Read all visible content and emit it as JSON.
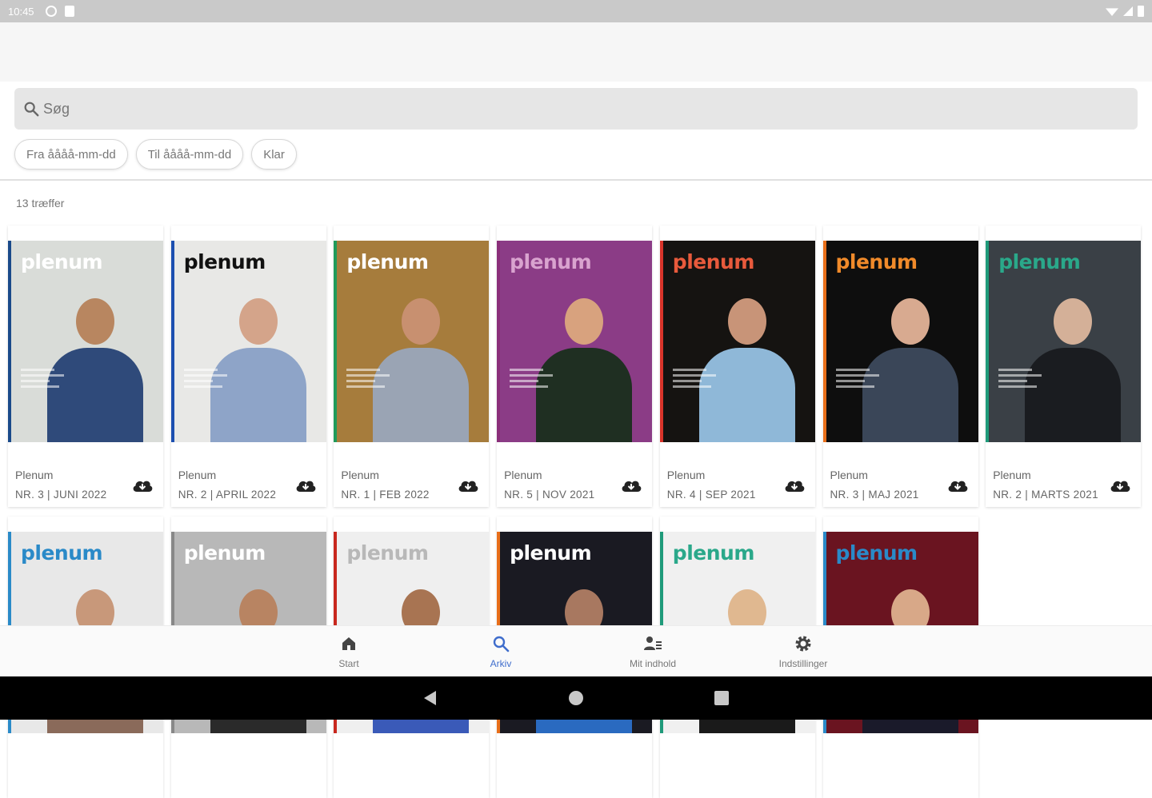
{
  "status_bar": {
    "time": "10:45"
  },
  "search": {
    "placeholder": "Søg"
  },
  "filters": {
    "from": "Fra åååå-mm-dd",
    "to": "Til åååå-mm-dd",
    "clear": "Klar"
  },
  "results": {
    "count_text": "13 træffer"
  },
  "magazines": [
    {
      "title": "Plenum",
      "issue": "NR. 3 | JUNI 2022",
      "mast": "plenum",
      "mast_color": "#ffffff",
      "accent": "#1a4a8a",
      "bg": "#d9dcd8",
      "skin": "#b88660",
      "cloth": "#2f4a7a"
    },
    {
      "title": "Plenum",
      "issue": "NR. 2 | APRIL 2022",
      "mast": "plenum",
      "mast_color": "#111111",
      "accent": "#1c4fb0",
      "bg": "#e8e8e6",
      "skin": "#d4a48a",
      "cloth": "#8ea4c8"
    },
    {
      "title": "Plenum",
      "issue": "NR. 1 | FEB 2022",
      "mast": "plenum",
      "mast_color": "#ffffff",
      "accent": "#1f9a5a",
      "bg": "#a67c3c",
      "skin": "#c89070",
      "cloth": "#9aa4b4"
    },
    {
      "title": "Plenum",
      "issue": "NR. 5 | NOV 2021",
      "mast": "plenum",
      "mast_color": "#d9a3cf",
      "accent": "#8a2f7a",
      "bg": "#8b3c86",
      "skin": "#d8a27e",
      "cloth": "#1f2f22"
    },
    {
      "title": "Plenum",
      "issue": "NR. 4 | SEP 2021",
      "mast": "plenum",
      "mast_color": "#e85a3c",
      "accent": "#d8342a",
      "bg": "#151311",
      "skin": "#c89478",
      "cloth": "#8fb8d8"
    },
    {
      "title": "Plenum",
      "issue": "NR. 3 | MAJ 2021",
      "mast": "plenum",
      "mast_color": "#f08a2a",
      "accent": "#e86f1a",
      "bg": "#0e0e0e",
      "skin": "#d8aa90",
      "cloth": "#3a4658"
    },
    {
      "title": "Plenum",
      "issue": "NR. 2 | MARTS 2021",
      "mast": "plenum",
      "mast_color": "#2aa88a",
      "accent": "#1f9a7a",
      "bg": "#3a4046",
      "skin": "#d4b098",
      "cloth": "#1a1c20"
    },
    {
      "title": "",
      "issue": "",
      "mast": "plenum",
      "mast_color": "#2a8ac8",
      "accent": "#2a8ac8",
      "bg": "#e8e8e8",
      "skin": "#c8987a",
      "cloth": "#8a6a5a"
    },
    {
      "title": "",
      "issue": "",
      "mast": "plenum",
      "mast_color": "#ffffff",
      "accent": "#888888",
      "bg": "#b8b8b8",
      "skin": "#b88462",
      "cloth": "#2a2a2a"
    },
    {
      "title": "",
      "issue": "",
      "mast": "plenum",
      "mast_color": "#b8b8b8",
      "accent": "#c8281e",
      "bg": "#efefef",
      "skin": "#a87452",
      "cloth": "#3a5ab8"
    },
    {
      "title": "",
      "issue": "",
      "mast": "plenum",
      "mast_color": "#ffffff",
      "accent": "#e86f1a",
      "bg": "#1a1a22",
      "skin": "#a87860",
      "cloth": "#2a6ac0"
    },
    {
      "title": "",
      "issue": "",
      "mast": "plenum",
      "mast_color": "#2aa88a",
      "accent": "#1f9a7a",
      "bg": "#f0f0f0",
      "skin": "#e0b890",
      "cloth": "#1a1a1a"
    },
    {
      "title": "",
      "issue": "",
      "mast": "plenum",
      "mast_color": "#2a8ac8",
      "accent": "#2a8ac8",
      "bg": "#6a1420",
      "skin": "#d8a888",
      "cloth": "#1a1a2a"
    }
  ],
  "bottom_nav": [
    {
      "label": "Start",
      "icon": "home-icon"
    },
    {
      "label": "Arkiv",
      "icon": "search-icon",
      "active": true
    },
    {
      "label": "Mit indhold",
      "icon": "person-list-icon"
    },
    {
      "label": "Indstillinger",
      "icon": "gear-icon"
    }
  ]
}
